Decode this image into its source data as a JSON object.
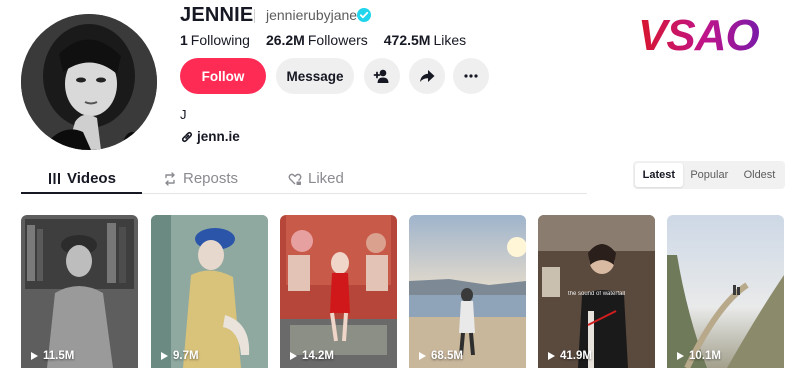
{
  "profile": {
    "username": "JENNIE",
    "handle": "jennierubyjane",
    "following_count": "1",
    "following_label": "Following",
    "followers_count": "26.2M",
    "followers_label": "Followers",
    "likes_count": "472.5M",
    "likes_label": "Likes",
    "bio": "J",
    "link": "jenn.ie"
  },
  "actions": {
    "follow_label": "Follow",
    "message_label": "Message"
  },
  "watermark": {
    "text": "VSAO"
  },
  "tabs": [
    {
      "label": "Videos",
      "icon": "grid-icon",
      "active": true
    },
    {
      "label": "Reposts",
      "icon": "repost-icon",
      "active": false
    },
    {
      "label": "Liked",
      "icon": "heart-lock-icon",
      "active": false
    }
  ],
  "sort": {
    "options": [
      "Latest",
      "Popular",
      "Oldest"
    ],
    "selected": "Latest"
  },
  "videos": [
    {
      "views": "11.5M"
    },
    {
      "views": "9.7M"
    },
    {
      "views": "14.2M"
    },
    {
      "views": "68.5M"
    },
    {
      "views": "41.9M",
      "caption": "the sound of waterfall"
    },
    {
      "views": "10.1M"
    }
  ],
  "colors": {
    "accent": "#fe2c55",
    "verified": "#20d5ec",
    "text": "#161823",
    "muted": "#8a8b91"
  }
}
